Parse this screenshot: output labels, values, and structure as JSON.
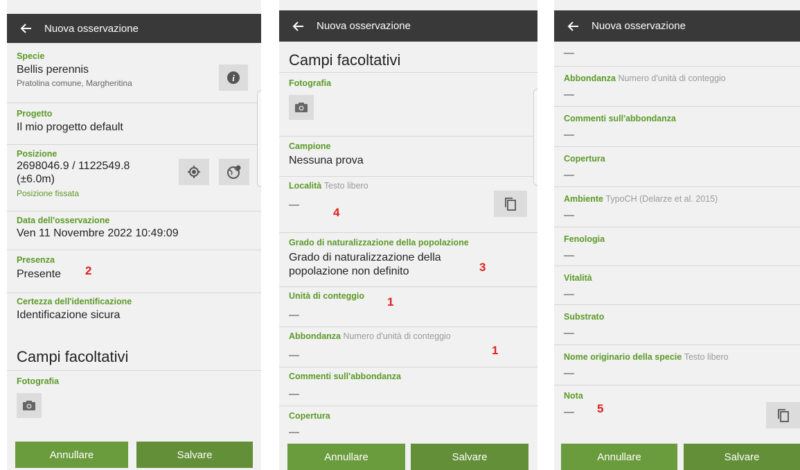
{
  "app": {
    "title": "Nuova osservazione"
  },
  "buttons": {
    "cancel": "Annullare",
    "save": "Salvare"
  },
  "fields": {
    "species": {
      "label": "Specie",
      "value": "Bellis perennis",
      "common": "Pratolina comune, Margheritina"
    },
    "project": {
      "label": "Progetto",
      "value": "Il mio progetto default"
    },
    "position": {
      "label": "Posizione",
      "value": "2698046.9 / 1122549.8",
      "accuracy": "(±6.0m)",
      "status": "Posizione fissata"
    },
    "date": {
      "label": "Data dell'osservazione",
      "value": "Ven 11 Novembre 2022 10:49:09"
    },
    "presence": {
      "label": "Presenza",
      "value": "Presente"
    },
    "certainty": {
      "label": "Certezza dell'identificazione",
      "value": "Identificazione sicura"
    },
    "optional_title": "Campi facoltativi",
    "photo": {
      "label": "Fotografia"
    },
    "sample": {
      "label": "Campione",
      "value": "Nessuna prova"
    },
    "locality": {
      "label": "Località",
      "hint": "Testo libero",
      "value": "—"
    },
    "naturalization": {
      "label": "Grado di naturalizzazione della popolazione",
      "value_line1": "Grado di naturalizzazione della",
      "value_line2": "popolazione non definito"
    },
    "count_unit": {
      "label": "Unità di conteggio",
      "value": "—"
    },
    "abundance": {
      "label": "Abbondanza",
      "hint": "Numero d'unità di conteggio",
      "value": "—"
    },
    "abundance_comments": {
      "label": "Commenti sull'abbondanza",
      "value": "—"
    },
    "coverage": {
      "label": "Copertura",
      "value": "—"
    },
    "habitat": {
      "label": "Ambiente",
      "hint": "TypoCH (Delarze et al. 2015)",
      "value": "—"
    },
    "phenology": {
      "label": "Fenologia",
      "value": "—"
    },
    "vitality": {
      "label": "Vitalità",
      "value": "—"
    },
    "substrate": {
      "label": "Substrato",
      "value": "—"
    },
    "original_name": {
      "label": "Nome originario della specie",
      "hint": "Testo libero",
      "value": "—"
    },
    "note": {
      "label": "Nota",
      "value": "—"
    }
  },
  "annotations": {
    "m1": "1",
    "m2": "2",
    "m3": "3",
    "m4": "4",
    "m5": "5"
  },
  "colors": {
    "appbar": "#393939",
    "accent_green": "#5b9a27",
    "button_green": "#6a9b3c",
    "annotation_red": "#e0201b"
  },
  "icons": [
    "back-arrow-icon",
    "info-icon",
    "gps-target-icon",
    "globe-pin-icon",
    "camera-icon",
    "copy-icon"
  ]
}
